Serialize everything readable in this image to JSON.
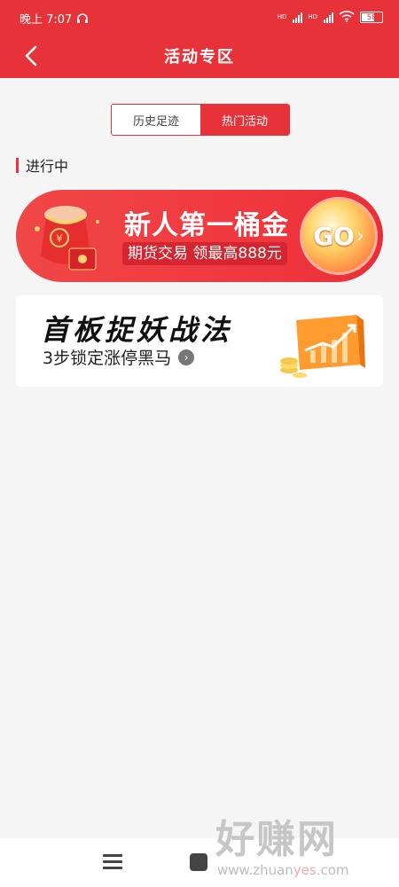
{
  "status_bar": {
    "time": "晚上 7:07",
    "battery": "58"
  },
  "header": {
    "title": "活动专区"
  },
  "tabs": [
    {
      "label": "历史足迹",
      "active": false
    },
    {
      "label": "热门活动",
      "active": true
    }
  ],
  "section": {
    "title": "进行中"
  },
  "banners": [
    {
      "title": "新人第一桶金",
      "subtitle": "期货交易 领最高888元",
      "cta": "GO"
    },
    {
      "title": "首板捉妖战法",
      "subtitle": "3步锁定涨停黑马"
    }
  ],
  "watermark": {
    "big": "好赚网",
    "domain_a": "www.zhuan",
    "domain_b": "yes",
    "domain_c": ".com"
  },
  "colors": {
    "brand_red": "#e8323a",
    "background": "#f5f5f5"
  }
}
